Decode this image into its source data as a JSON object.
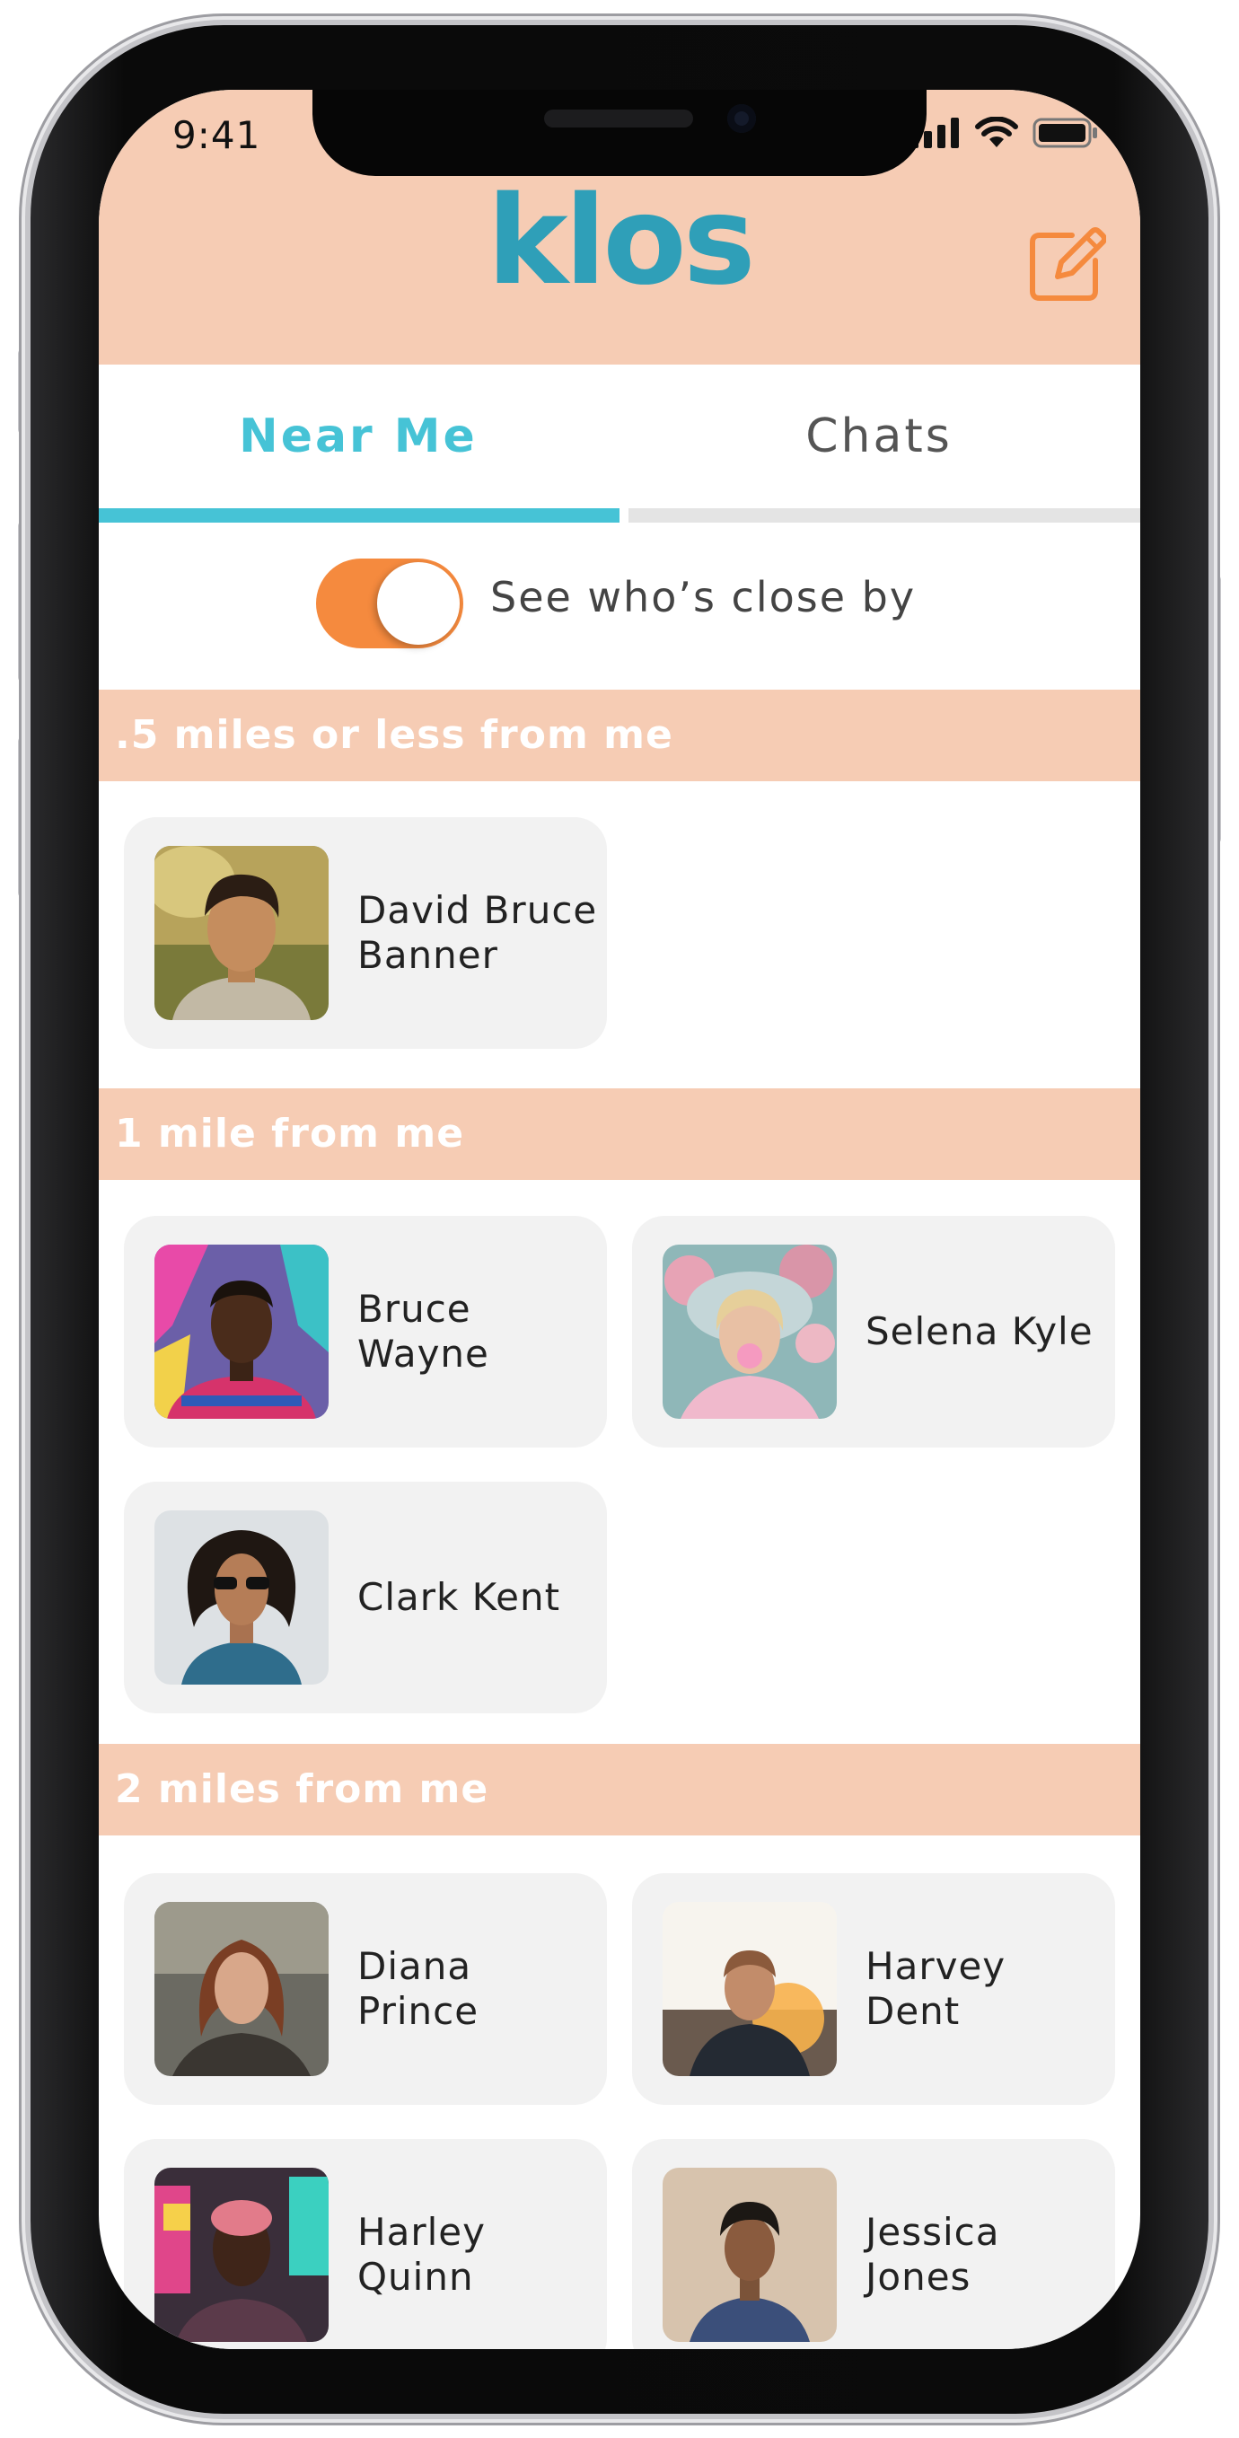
{
  "status_bar": {
    "time": "9:41"
  },
  "header": {
    "logo": "klos"
  },
  "tabs": [
    {
      "label": "Near Me"
    },
    {
      "label": "Chats"
    }
  ],
  "toggle": {
    "label": "See who’s close by",
    "on": true
  },
  "sections": [
    {
      "title": ".5 miles or less from me",
      "people": [
        {
          "name": "David Bruce Banner"
        }
      ]
    },
    {
      "title": "1 mile from me",
      "people": [
        {
          "name": "Bruce Wayne"
        },
        {
          "name": "Selena Kyle"
        },
        {
          "name": "Clark Kent"
        }
      ]
    },
    {
      "title": "2 miles from me",
      "people": [
        {
          "name": "Diana Prince"
        },
        {
          "name": "Harvey Dent"
        },
        {
          "name": "Harley Quinn"
        },
        {
          "name": "Jessica Jones"
        }
      ]
    }
  ],
  "colors": {
    "header_bg": "#f6ccb4",
    "accent_teal": "#46c3d6",
    "logo": "#2f9fb8",
    "toggle_on": "#f58a3e",
    "card_bg": "#f2f2f2"
  },
  "icons": [
    "signal-icon",
    "wifi-icon",
    "battery-icon",
    "compose-icon"
  ]
}
